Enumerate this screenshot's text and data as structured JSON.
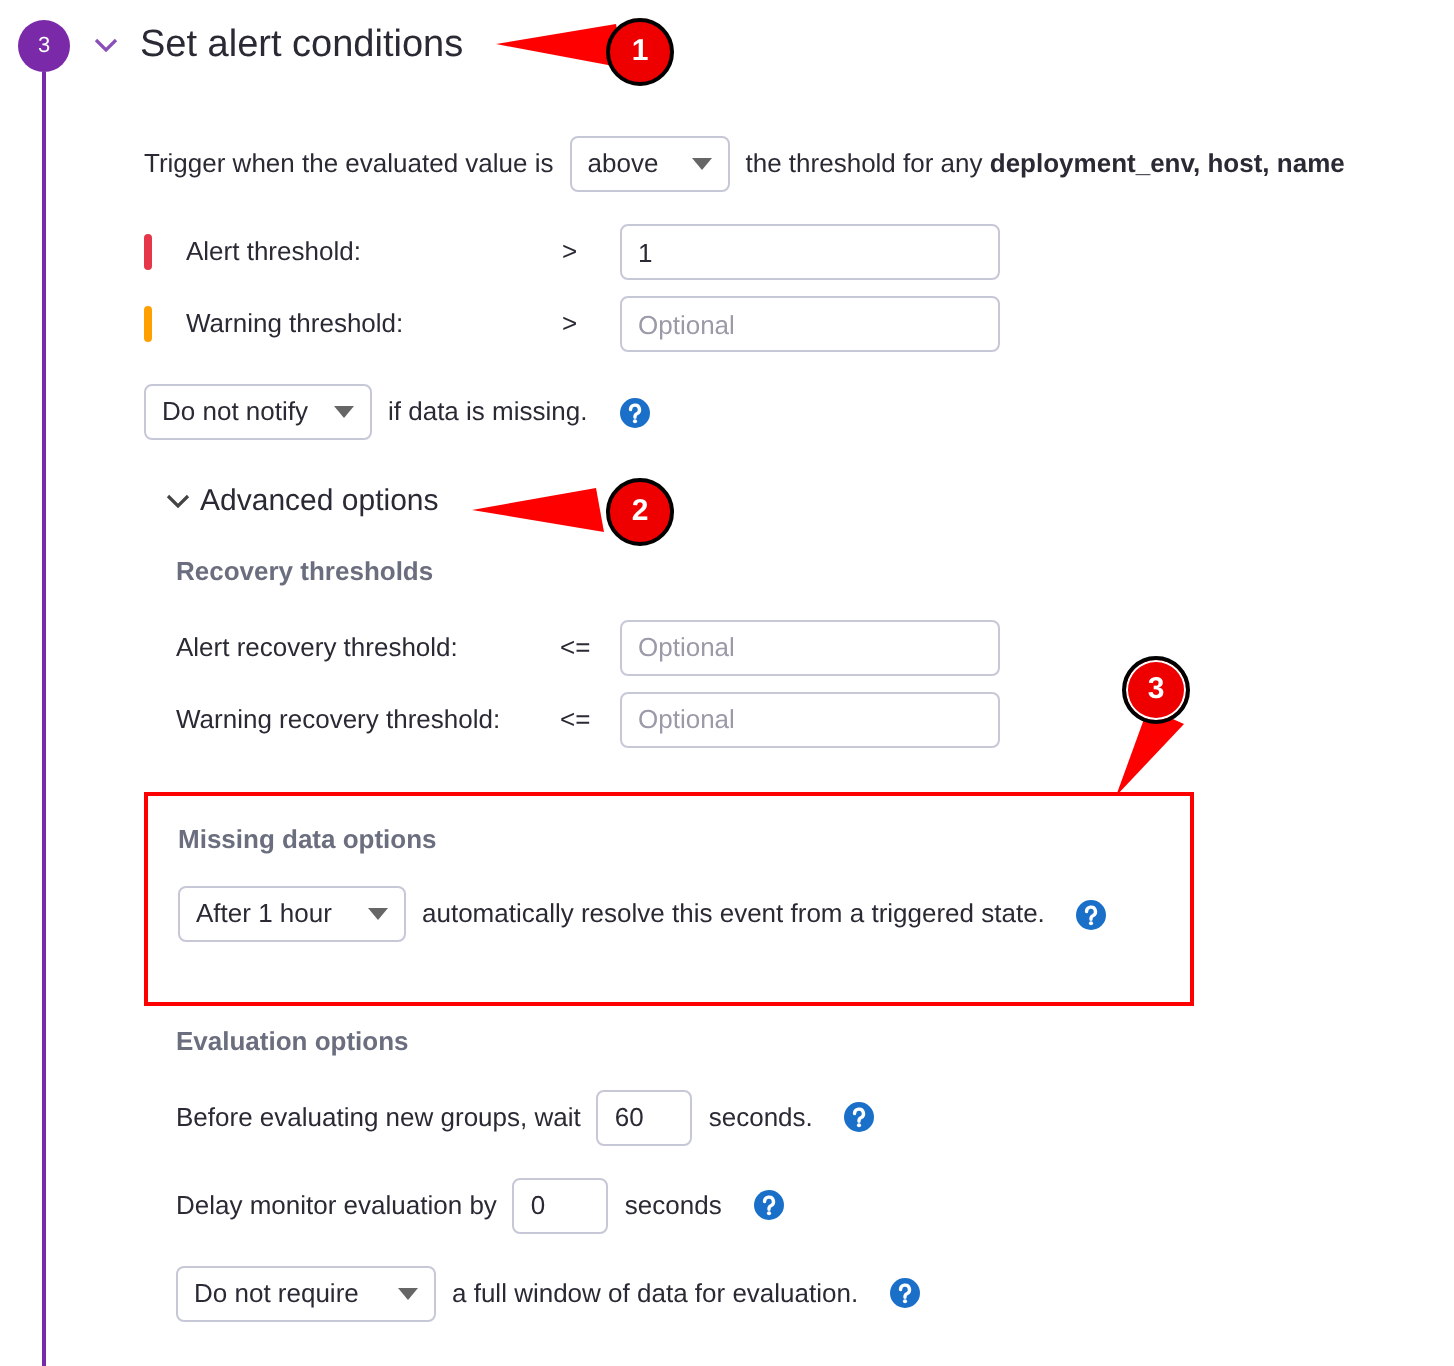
{
  "step": {
    "number": "3",
    "title": "Set alert conditions",
    "expanded": true
  },
  "trigger": {
    "before": "Trigger when the evaluated value is",
    "select": "above",
    "after": "the threshold for any **deployment_env, host, name**"
  },
  "thresholds": [
    {
      "label": "Alert threshold:",
      "color": "#e5364a",
      "operator": ">",
      "value": "1"
    },
    {
      "label": "Warning threshold:",
      "color": "#ff9f00",
      "operator": ">",
      "placeholder": "Optional"
    }
  ],
  "missing_notify": {
    "select": "Do not notify",
    "text": "if data is missing."
  },
  "advanced": {
    "title": "Advanced options",
    "expanded": true,
    "recovery": {
      "heading": "Recovery thresholds",
      "rows": [
        {
          "label": "Alert recovery threshold:",
          "operator": "<=",
          "placeholder": "Optional"
        },
        {
          "label": "Warning recovery threshold:",
          "operator": "<=",
          "placeholder": "Optional"
        }
      ]
    },
    "missing": {
      "heading": "Missing data options",
      "select": "After 1 hour",
      "text": "automatically resolve this event from a triggered state.",
      "highlighted": true
    },
    "evaluation": {
      "heading": "Evaluation options",
      "rows": [
        {
          "kind": "input",
          "before": "Before evaluating new groups, wait",
          "value": "60",
          "after": "seconds."
        },
        {
          "kind": "input",
          "before": "Delay monitor evaluation by",
          "value": "0",
          "after": "seconds"
        },
        {
          "kind": "select",
          "select": "Do not require",
          "after": "a full window of data for evaluation."
        }
      ]
    }
  },
  "callouts": [
    "1",
    "2",
    "3"
  ]
}
